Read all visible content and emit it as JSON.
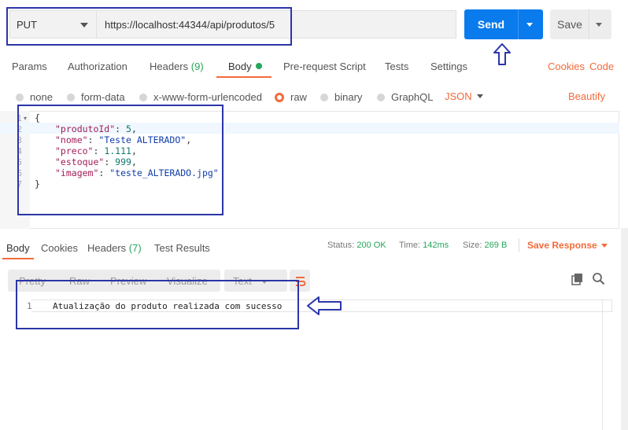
{
  "request": {
    "method": "PUT",
    "url": "https://localhost:44344/api/produtos/5",
    "send_label": "Send",
    "save_label": "Save"
  },
  "request_tabs": {
    "params": "Params",
    "authorization": "Authorization",
    "headers": "Headers",
    "headers_count": "(9)",
    "body": "Body",
    "prerequest": "Pre-request Script",
    "tests": "Tests",
    "settings": "Settings",
    "cookies": "Cookies",
    "code": "Code"
  },
  "body_types": {
    "none": "none",
    "form_data": "form-data",
    "urlencoded": "x-www-form-urlencoded",
    "raw": "raw",
    "binary": "binary",
    "graphql": "GraphQL",
    "format": "JSON",
    "beautify": "Beautify"
  },
  "editor": {
    "line_numbers": [
      "1",
      "2",
      "3",
      "4",
      "5",
      "6",
      "7"
    ],
    "open_brace": "{",
    "close_brace": "}",
    "fields": [
      {
        "key": "\"produtoId\"",
        "value": "5",
        "type": "number"
      },
      {
        "key": "\"nome\"",
        "value": "\"Teste ALTERADO\"",
        "type": "string"
      },
      {
        "key": "\"preco\"",
        "value": "1.111",
        "type": "number"
      },
      {
        "key": "\"estoque\"",
        "value": "999",
        "type": "number"
      },
      {
        "key": "\"imagem\"",
        "value": "\"teste_ALTERADO.jpg\"",
        "type": "string"
      }
    ]
  },
  "response_tabs": {
    "body": "Body",
    "cookies": "Cookies",
    "headers": "Headers",
    "headers_count": "(7)",
    "test_results": "Test Results"
  },
  "response_status": {
    "status_label": "Status:",
    "status_value": "200 OK",
    "time_label": "Time:",
    "time_value": "142ms",
    "size_label": "Size:",
    "size_value": "269 B",
    "save_response": "Save Response"
  },
  "response_format": {
    "pretty": "Pretty",
    "raw": "Raw",
    "preview": "Preview",
    "visualize": "Visualize",
    "text": "Text"
  },
  "response_body": {
    "line_number": "1",
    "text": "Atualização do produto realizada com sucesso"
  },
  "colors": {
    "accent": "#f26b3a",
    "send": "#097bed",
    "success": "#26a65b",
    "annotation": "#2b35a8"
  }
}
